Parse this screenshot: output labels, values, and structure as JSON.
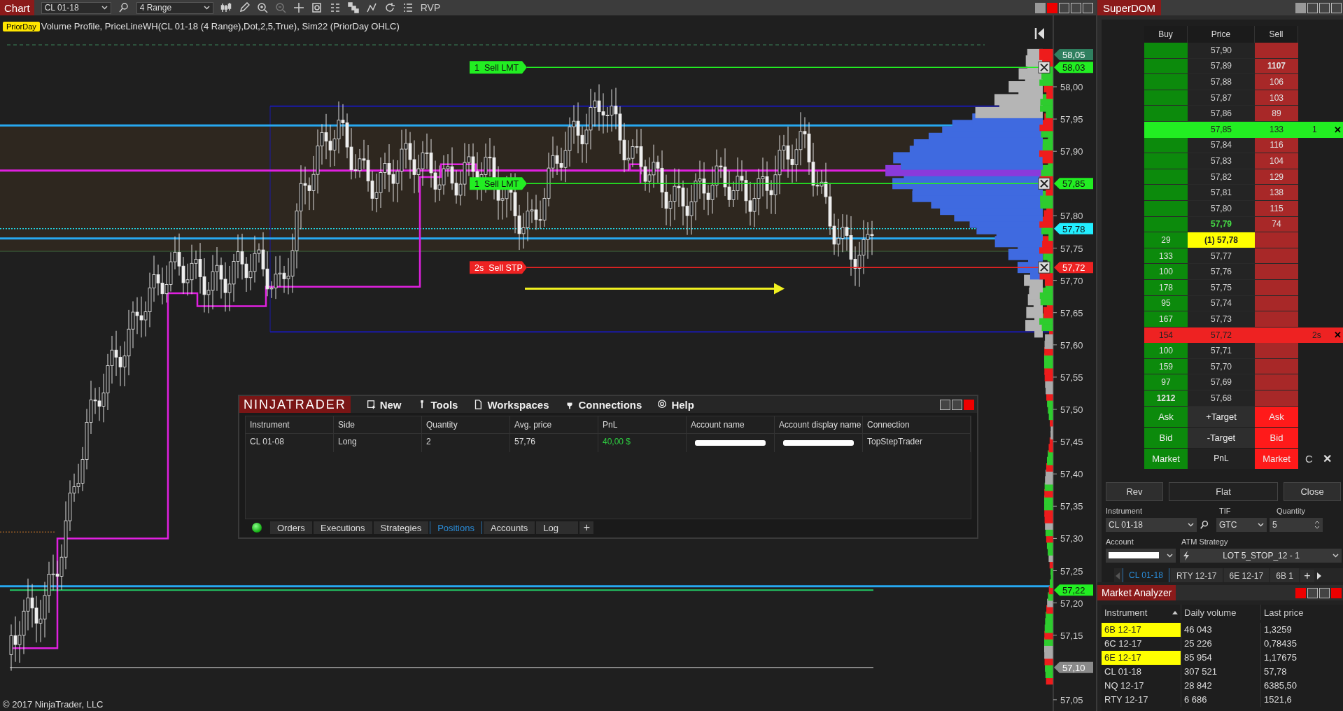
{
  "chart_window": {
    "title": "Chart",
    "instrument": "CL 01-18",
    "bar_type": "4 Range",
    "toolbar_label": "RVP",
    "badge": "PriorDay",
    "indicators": "Volume Profile, PriceLineWH(CL 01-18 (4 Range),Dot,2,5,True), Sim22 (PriorDay OHLC)",
    "copyright": "© 2017 NinjaTrader, LLC",
    "price_axis": [
      "58,00",
      "57,95",
      "57,90",
      "57,80",
      "57,75",
      "57,70",
      "57,65",
      "57,60",
      "57,55",
      "57,50",
      "57,45",
      "57,40",
      "57,35",
      "57,30",
      "57,25",
      "57,20",
      "57,15",
      "57,05"
    ],
    "price_markers": [
      {
        "text": "58,05",
        "color": "#2f7f5f"
      },
      {
        "text": "58,03",
        "color": "#22ee22"
      },
      {
        "text": "57,85",
        "color": "#22ee22"
      },
      {
        "text": "57,78",
        "color": "#22eeff"
      },
      {
        "text": "57,72",
        "color": "#ee2222"
      },
      {
        "text": "57,22",
        "color": "#22ee22"
      },
      {
        "text": "57,10",
        "color": "#8a8a8a"
      }
    ],
    "orders": [
      {
        "label": "1  Sell LMT",
        "color": "#22ee22"
      },
      {
        "label": "1  Sell LMT",
        "color": "#22ee22"
      },
      {
        "label": "2s  Sell STP",
        "color": "#ee2222"
      }
    ]
  },
  "control_center": {
    "brand": "NINJATRADER",
    "menu": [
      "New",
      "Tools",
      "Workspaces",
      "Connections",
      "Help"
    ],
    "columns": [
      "Instrument",
      "Side",
      "Quantity",
      "Avg. price",
      "PnL",
      "Account name",
      "Account display name",
      "Connection"
    ],
    "rows": [
      [
        {
          "kind": "text",
          "text": "CL 01-08"
        },
        {
          "kind": "text",
          "text": "Long"
        },
        {
          "kind": "text",
          "text": "2"
        },
        {
          "kind": "text",
          "text": "57,76"
        },
        {
          "kind": "profit",
          "text": "40,00 $"
        },
        {
          "kind": "redacted"
        },
        {
          "kind": "redacted"
        },
        {
          "kind": "text",
          "text": "TopStepTrader"
        }
      ]
    ],
    "tabs": [
      {
        "label": "Orders",
        "selected": false
      },
      {
        "label": "Executions",
        "selected": false
      },
      {
        "label": "Strategies",
        "selected": false
      },
      {
        "label": "Positions",
        "selected": true
      },
      {
        "label": "Accounts",
        "selected": false
      },
      {
        "label": "Log",
        "selected": false
      }
    ],
    "add_tab": "+"
  },
  "superdom": {
    "title": "SuperDOM",
    "columns": [
      "Buy",
      "Price",
      "Sell"
    ],
    "rows": [
      {
        "kind": "level",
        "price": "57,90"
      },
      {
        "kind": "level",
        "price": "57,89",
        "sell": "1107",
        "large": true
      },
      {
        "kind": "level",
        "price": "57,88",
        "sell": "106",
        "large": false
      },
      {
        "kind": "level",
        "price": "57,87",
        "sell": "103",
        "large": false
      },
      {
        "kind": "level",
        "price": "57,86",
        "sell": "89",
        "large": false
      },
      {
        "kind": "order",
        "price": "57,85",
        "sell": "133",
        "order": "1",
        "color": "#22ee22",
        "cancel": "✕",
        "large": false
      },
      {
        "kind": "level",
        "price": "57,84",
        "sell": "116",
        "large": false
      },
      {
        "kind": "level",
        "price": "57,83",
        "sell": "104",
        "large": false
      },
      {
        "kind": "level",
        "price": "57,82",
        "sell": "129",
        "large": false
      },
      {
        "kind": "level",
        "price": "57,81",
        "sell": "138",
        "large": false
      },
      {
        "kind": "level",
        "price": "57,80",
        "sell": "115",
        "large": false
      },
      {
        "kind": "ask",
        "price": "57,79",
        "sell": "74",
        "large": false
      },
      {
        "kind": "last",
        "price": "(1) 57,78",
        "buy": "29",
        "large": false
      },
      {
        "kind": "level",
        "price": "57,77",
        "buy": "133",
        "large": false
      },
      {
        "kind": "level",
        "price": "57,76",
        "buy": "100",
        "large": false
      },
      {
        "kind": "level",
        "price": "57,75",
        "buy": "178",
        "large": false
      },
      {
        "kind": "level",
        "price": "57,74",
        "buy": "95",
        "large": false
      },
      {
        "kind": "level",
        "price": "57,73",
        "buy": "167",
        "large": false
      },
      {
        "kind": "order",
        "price": "57,72",
        "buy": "154",
        "order": "2s",
        "color": "#ee2222",
        "cancel": "✕",
        "large": false
      },
      {
        "kind": "level",
        "price": "57,71",
        "buy": "100",
        "large": false
      },
      {
        "kind": "level",
        "price": "57,70",
        "buy": "159",
        "large": false
      },
      {
        "kind": "level",
        "price": "57,69",
        "buy": "97",
        "large": false
      },
      {
        "kind": "level",
        "price": "57,68",
        "buy": "1212",
        "large": true
      }
    ],
    "action_rows": [
      [
        "Ask",
        "+Target",
        "Ask"
      ],
      [
        "Bid",
        "-Target",
        "Bid"
      ],
      [
        "Market",
        "PnL",
        "Market"
      ]
    ],
    "center_text": "C",
    "close_glyph": "✕",
    "buttons": [
      "Rev",
      "Flat",
      "Close"
    ],
    "instrument_label": "Instrument",
    "instrument": "CL 01-18",
    "tif_label": "TIF",
    "tif": "GTC",
    "quantity_label": "Quantity",
    "quantity": "5",
    "account_label": "Account",
    "atm_label": "ATM Strategy",
    "atm": "LOT 5_STOP_12 - 1",
    "tabs": [
      {
        "label": "CL 01-18",
        "selected": true
      },
      {
        "label": "RTY 12-17",
        "selected": false
      },
      {
        "label": "6E 12-17",
        "selected": false
      },
      {
        "label": "6B 1",
        "selected": false
      }
    ],
    "add_tab": "+"
  },
  "market_analyzer": {
    "title": "Market Analyzer",
    "columns": [
      "Instrument",
      "Daily volume",
      "Last price"
    ],
    "rows": [
      {
        "instrument": "6B 12-17",
        "volume": "46 043",
        "last": "1,3259",
        "highlighted": true
      },
      {
        "instrument": "6C 12-17",
        "volume": "25 226",
        "last": "0,78435",
        "highlighted": false
      },
      {
        "instrument": "6E 12-17",
        "volume": "85 954",
        "last": "1,17675",
        "highlighted": true
      },
      {
        "instrument": "CL 01-18",
        "volume": "307 521",
        "last": "57,78",
        "highlighted": false
      },
      {
        "instrument": "NQ 12-17",
        "volume": "28 842",
        "last": "6385,50",
        "highlighted": false
      },
      {
        "instrument": "RTY 12-17",
        "volume": "6 686",
        "last": "1521,6",
        "highlighted": false
      }
    ]
  }
}
